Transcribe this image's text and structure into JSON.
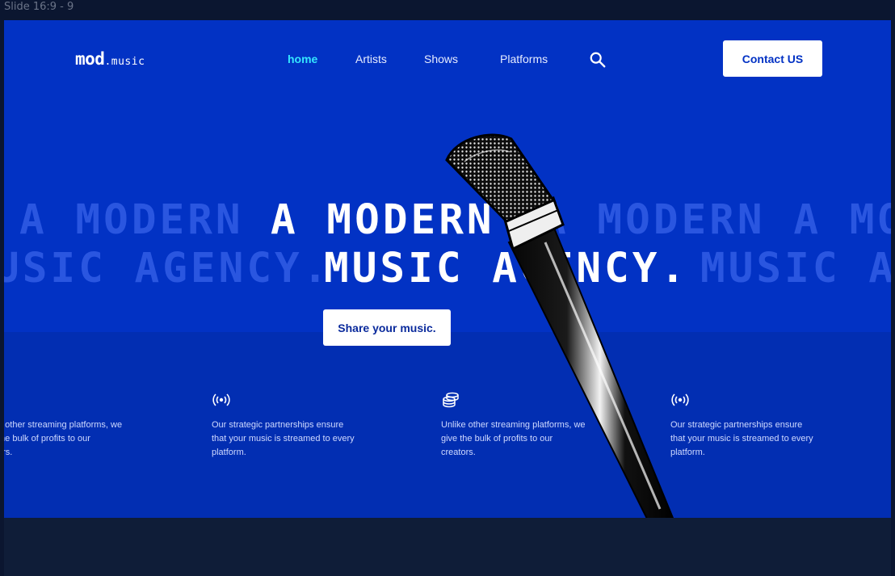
{
  "canvas": {
    "label": "Slide 16:9 - 9"
  },
  "header": {
    "logo_main": "mod",
    "logo_sub": ".music",
    "nav": [
      {
        "label": "home",
        "active": true
      },
      {
        "label": "Artists",
        "active": false
      },
      {
        "label": "Shows",
        "active": false
      },
      {
        "label": "Platforms",
        "active": false
      }
    ],
    "search_icon": "search-icon",
    "contact_label": "Contact US"
  },
  "hero": {
    "line1": "A MODERN",
    "line2": "MUSIC AGENCY.",
    "ghost_line1_left": "A MODERN",
    "ghost_line1_right": "A MODERN A MO",
    "ghost_line2_left": "USIC AGENCY.",
    "ghost_line2_right": "MUSIC A",
    "cta_label": "Share your music."
  },
  "features": [
    {
      "icon": "",
      "text_lines": [
        "e other streaming platforms, we",
        "the bulk of profits to our",
        "ors."
      ]
    },
    {
      "icon": "broadcast-icon",
      "text_lines": [
        "Our strategic partnerships ensure",
        "that your music is streamed to every",
        "platform."
      ]
    },
    {
      "icon": "coins-stack-icon",
      "text_lines": [
        "Unlike other streaming platforms, we",
        "give the bulk of profits to our",
        "creators."
      ]
    },
    {
      "icon": "broadcast-icon",
      "text_lines": [
        "Our strategic partnerships ensure",
        "that your music is streamed to every",
        "platform."
      ]
    }
  ],
  "colors": {
    "hero_bg": "#0232c4",
    "band_bg": "#022eb2",
    "ghost_text": "#2a56e0",
    "nav_active": "#35e6ff",
    "page_bg": "#0b1630"
  }
}
